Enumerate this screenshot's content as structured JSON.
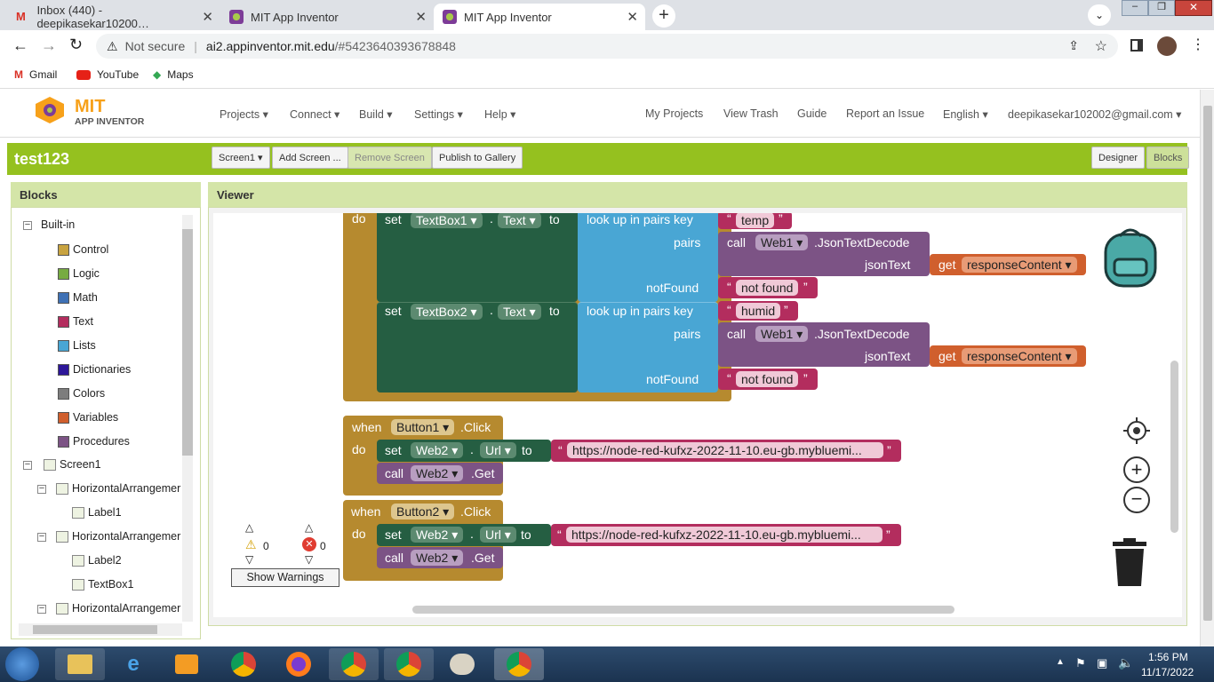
{
  "browser": {
    "tabs": [
      {
        "title": "Inbox (440) - deepikasekar10200…",
        "active": false
      },
      {
        "title": "MIT App Inventor",
        "active": false
      },
      {
        "title": "MIT App Inventor",
        "active": true
      }
    ],
    "not_secure": "Not secure",
    "url_host": "ai2.appinventor.mit.edu",
    "url_path": "/#5423640393678848",
    "bookmarks": [
      "Gmail",
      "YouTube",
      "Maps"
    ]
  },
  "app": {
    "logo_top": "MIT",
    "logo_bottom": "APP INVENTOR",
    "nav": [
      "Projects ▾",
      "Connect ▾",
      "Build ▾",
      "Settings ▾",
      "Help ▾"
    ],
    "right_nav": [
      "My Projects",
      "View Trash",
      "Guide",
      "Report an Issue",
      "English ▾",
      "deepikasekar102002@gmail.com ▾"
    ],
    "project_name": "test123",
    "screen_select": "Screen1 ▾",
    "add_screen": "Add Screen ...",
    "remove_screen": "Remove Screen",
    "publish": "Publish to Gallery",
    "designer": "Designer",
    "blocks": "Blocks"
  },
  "blocks_panel": {
    "title": "Blocks",
    "builtin_label": "Built-in",
    "builtin": [
      {
        "label": "Control",
        "color": "#c8a340"
      },
      {
        "label": "Logic",
        "color": "#77ab41"
      },
      {
        "label": "Math",
        "color": "#3f71b5"
      },
      {
        "label": "Text",
        "color": "#b32d5e"
      },
      {
        "label": "Lists",
        "color": "#49a6d4"
      },
      {
        "label": "Dictionaries",
        "color": "#2d1799"
      },
      {
        "label": "Colors",
        "color": "#7d7d7d"
      },
      {
        "label": "Variables",
        "color": "#d05f2d"
      },
      {
        "label": "Procedures",
        "color": "#7c5385"
      }
    ],
    "components": [
      {
        "label": "Screen1",
        "level": 0
      },
      {
        "label": "HorizontalArrangemer",
        "level": 1
      },
      {
        "label": "Label1",
        "level": 2
      },
      {
        "label": "HorizontalArrangemer",
        "level": 1
      },
      {
        "label": "Label2",
        "level": 2
      },
      {
        "label": "TextBox1",
        "level": 2
      },
      {
        "label": "HorizontalArrangemer",
        "level": 1
      }
    ]
  },
  "viewer": {
    "title": "Viewer",
    "warnings_count": "0",
    "errors_count": "0",
    "show_warnings": "Show Warnings",
    "blocks": {
      "do": "do",
      "set": "set",
      "to": "to",
      "call": "call",
      "when": "when",
      "textbox1": "TextBox1 ▾",
      "textbox2": "TextBox2 ▾",
      "text_prop": "Text ▾",
      "lookup": "look up in pairs  key",
      "pairs": "pairs",
      "notfound_label": "notFound",
      "jsontext": "jsonText",
      "get": "get",
      "web1": "Web1 ▾",
      "json_decode": ".JsonTextDecode",
      "response": "responseContent ▾",
      "key_temp": "temp",
      "key_humid": "humid",
      "not_found": "not found",
      "button1": "Button1 ▾",
      "button2": "Button2 ▾",
      "click": ".Click",
      "web2": "Web2 ▾",
      "url_prop": "Url ▾",
      "url": "https://node-red-kufxz-2022-11-10.eu-gb.mybluemi...",
      "get_method": ".Get",
      "quote_open": "“",
      "quote_close": "”"
    }
  },
  "taskbar": {
    "time": "1:56 PM",
    "date": "11/17/2022"
  }
}
